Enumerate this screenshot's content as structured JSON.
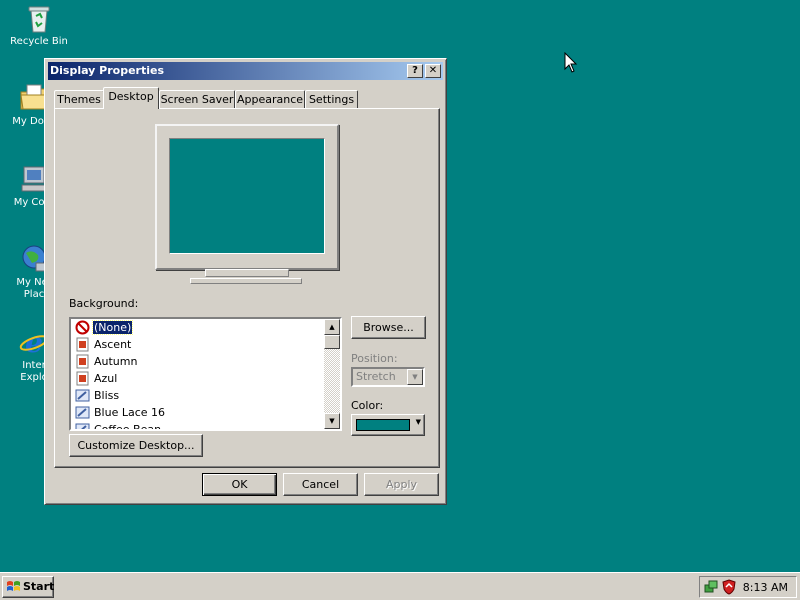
{
  "desktop": {
    "background_color": "#008080",
    "icons": [
      {
        "label": "Recycle Bin",
        "icon": "recycle-bin-icon"
      },
      {
        "label": "My Docu",
        "icon": "my-documents-icon"
      },
      {
        "label": "My Com",
        "icon": "my-computer-icon"
      },
      {
        "label": "My Net",
        "label2": "Plac",
        "icon": "my-network-places-icon"
      },
      {
        "label": "Inter",
        "label2": "Explo",
        "icon": "internet-explorer-icon"
      }
    ]
  },
  "window": {
    "title": "Display Properties",
    "help_button": "?",
    "close_button": "✕",
    "tabs": [
      {
        "label": "Themes",
        "active": false
      },
      {
        "label": "Desktop",
        "active": true
      },
      {
        "label": "Screen Saver",
        "active": false
      },
      {
        "label": "Appearance",
        "active": false
      },
      {
        "label": "Settings",
        "active": false
      }
    ],
    "background_label": "Background:",
    "backgrounds": [
      {
        "label": "(None)",
        "icon": "none-icon",
        "selected": true
      },
      {
        "label": "Ascent",
        "icon": "image-file-icon"
      },
      {
        "label": "Autumn",
        "icon": "image-file-icon"
      },
      {
        "label": "Azul",
        "icon": "image-file-icon"
      },
      {
        "label": "Bliss",
        "icon": "bitmap-file-icon"
      },
      {
        "label": "Blue Lace 16",
        "icon": "bitmap-file-icon"
      },
      {
        "label": "Coffee Bean",
        "icon": "bitmap-file-icon"
      }
    ],
    "browse_button": "Browse...",
    "position_label": "Position:",
    "position_value": "Stretch",
    "color_label": "Color:",
    "color_value": "#008080",
    "customize_button": "Customize Desktop...",
    "ok_button": "OK",
    "cancel_button": "Cancel",
    "apply_button": "Apply"
  },
  "taskbar": {
    "start_label": "Start",
    "clock": "8:13 AM",
    "tray_icons": [
      "network-tray-icon",
      "security-shield-icon"
    ]
  }
}
